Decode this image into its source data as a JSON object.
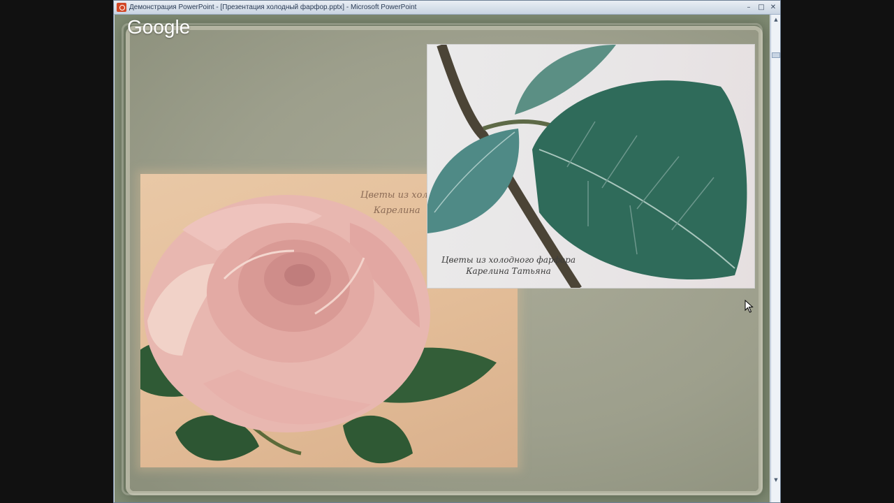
{
  "window": {
    "title": "Демонстрация PowerPoint - [Презентация холодный фарфор.pptx] - Microsoft PowerPoint",
    "buttons": {
      "minimize": "–",
      "maximize": "□",
      "close": "✕"
    }
  },
  "overlay": {
    "brand": "Google"
  },
  "slide": {
    "photo_rose": {
      "caption_line1": "Цветы из холо",
      "caption_line2": "Карелина"
    },
    "photo_leaf": {
      "caption_line1": "Цветы из холодного фарфора",
      "caption_line2": "Карелина Татьяна"
    }
  },
  "scrollbar": {
    "up": "▲",
    "down": "▼"
  },
  "colors": {
    "slide_frame": "#7f8a73",
    "paper": "#9d9f8c",
    "rose_background": "#e3bd98",
    "leaf_background": "#e8e5e6",
    "leaf_green": "#2f6b5a"
  }
}
